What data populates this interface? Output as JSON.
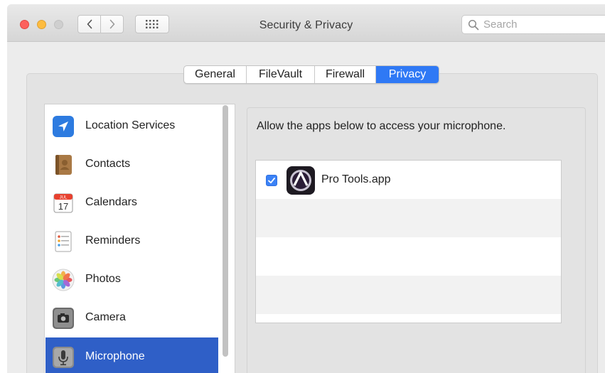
{
  "window": {
    "title": "Security & Privacy",
    "search_placeholder": "Search"
  },
  "toolbar": {
    "back_icon": "chevron-left-icon",
    "forward_icon": "chevron-right-icon",
    "grid_icon": "show-all-grid-icon"
  },
  "tabs": [
    {
      "label": "General",
      "selected": false
    },
    {
      "label": "FileVault",
      "selected": false
    },
    {
      "label": "Firewall",
      "selected": false
    },
    {
      "label": "Privacy",
      "selected": true
    }
  ],
  "sidebar": {
    "items": [
      {
        "label": "Location Services",
        "icon": "location-arrow-icon",
        "selected": false
      },
      {
        "label": "Contacts",
        "icon": "contacts-book-icon",
        "selected": false
      },
      {
        "label": "Calendars",
        "icon": "calendar-icon",
        "selected": false
      },
      {
        "label": "Reminders",
        "icon": "reminders-list-icon",
        "selected": false
      },
      {
        "label": "Photos",
        "icon": "photos-flower-icon",
        "selected": false
      },
      {
        "label": "Camera",
        "icon": "camera-icon",
        "selected": false
      },
      {
        "label": "Microphone",
        "icon": "microphone-icon",
        "selected": true
      }
    ],
    "calendar_icon": {
      "month": "JUL",
      "day": "17"
    }
  },
  "main": {
    "prompt": "Allow the apps below to access your microphone.",
    "apps": [
      {
        "name": "Pro Tools.app",
        "checked": true,
        "icon": "pro-tools-app-icon"
      }
    ]
  },
  "colors": {
    "accent": "#2f79f5",
    "sidebar_selection": "#2f5fc7",
    "close": "#fc615d",
    "minimize": "#fdbc40"
  }
}
